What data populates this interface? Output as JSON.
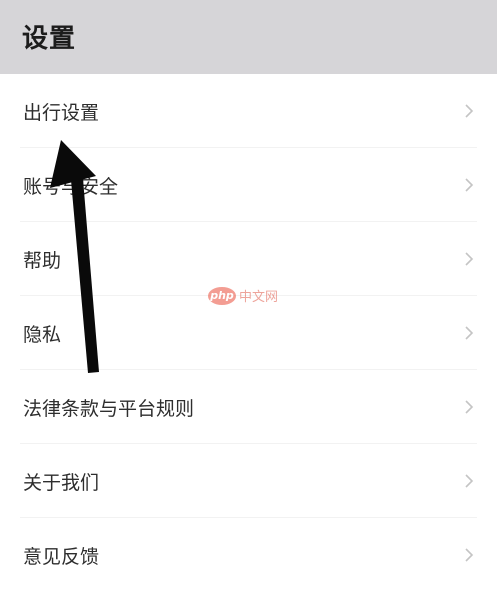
{
  "header": {
    "title": "设置"
  },
  "menu": {
    "items": [
      {
        "label": "出行设置"
      },
      {
        "label": "账号与安全"
      },
      {
        "label": "帮助"
      },
      {
        "label": "隐私"
      },
      {
        "label": "法律条款与平台规则"
      },
      {
        "label": "关于我们"
      },
      {
        "label": "意见反馈"
      }
    ]
  },
  "watermark": {
    "badge": "php",
    "text": "中文网"
  },
  "icons": {
    "chevron": "chevron-right-icon",
    "annotation": "arrow-up-annotation"
  },
  "colors": {
    "header_bg": "#d6d5d8",
    "text": "#2e2e2e",
    "chevron": "#c4c4c4",
    "arrow": "#0a0a0a",
    "watermark": "#ea4e3c"
  }
}
